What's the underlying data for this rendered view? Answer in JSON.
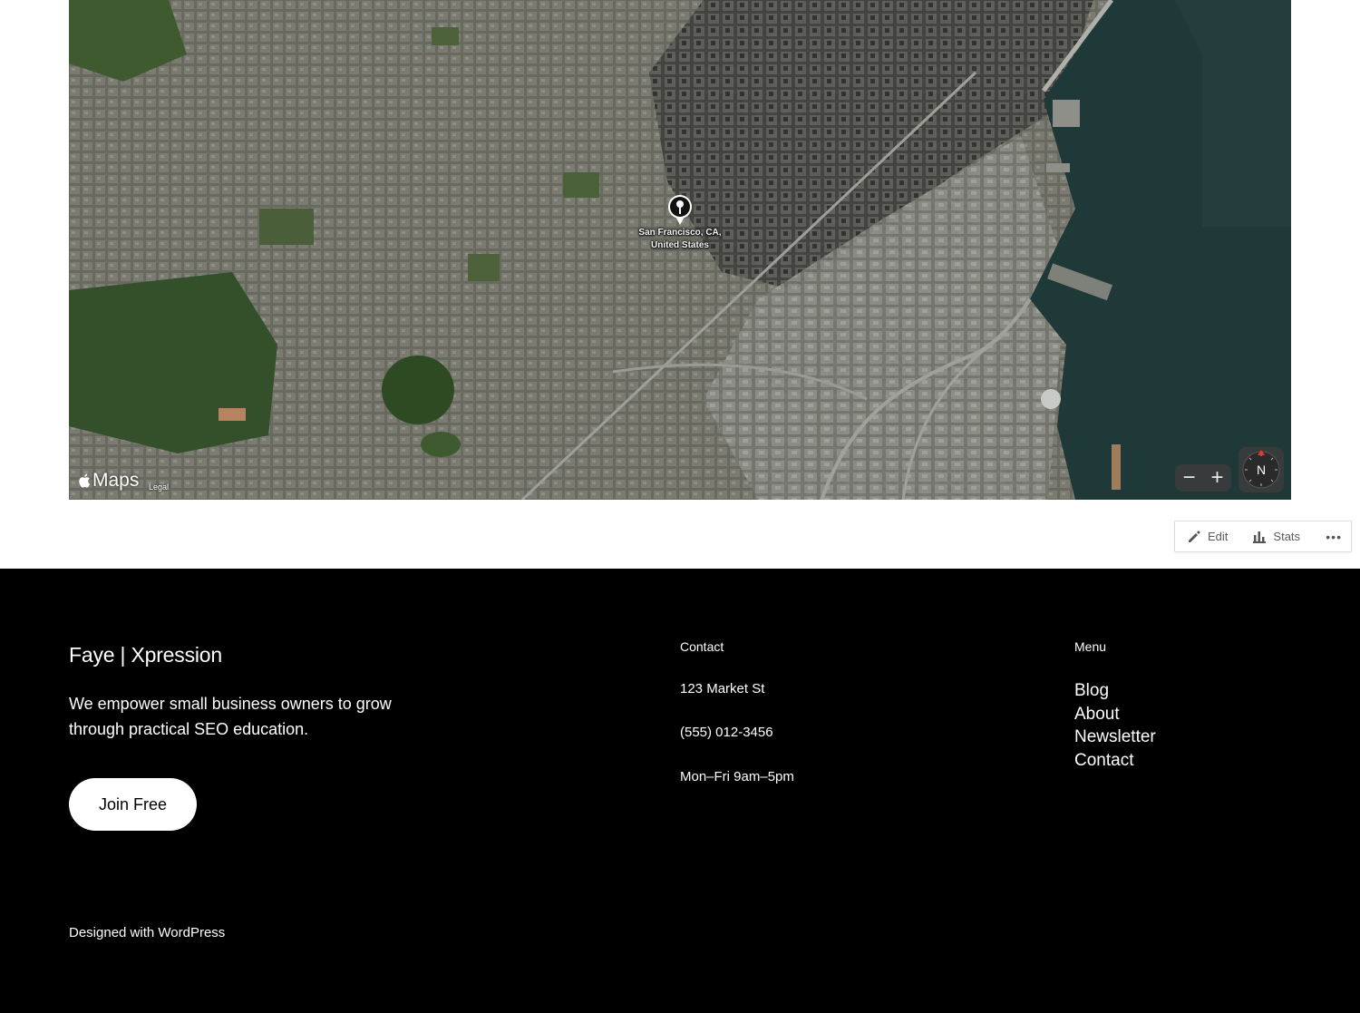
{
  "map": {
    "pin_label": "San Francisco, CA, United States",
    "brand": "Maps",
    "legal": "Legal",
    "zoom_out": "−",
    "zoom_in": "+",
    "compass": "N"
  },
  "admin_bar": {
    "edit": "Edit",
    "stats": "Stats",
    "more": "•••"
  },
  "footer": {
    "site_title": "Faye | Xpression",
    "tagline": "We empower small business owners to grow through practical SEO education.",
    "cta": "Join Free",
    "contact": {
      "heading": "Contact",
      "address": "123 Market St",
      "phone": "(555) 012-3456",
      "hours": "Mon–Fri 9am–5pm"
    },
    "menu": {
      "heading": "Menu",
      "items": [
        "Blog",
        "About",
        "Newsletter",
        "Contact"
      ]
    },
    "credit": "Designed with WordPress"
  },
  "colors": {
    "footer_bg": "#000000",
    "page_bg": "#ffffff",
    "water": "#1f3838"
  }
}
